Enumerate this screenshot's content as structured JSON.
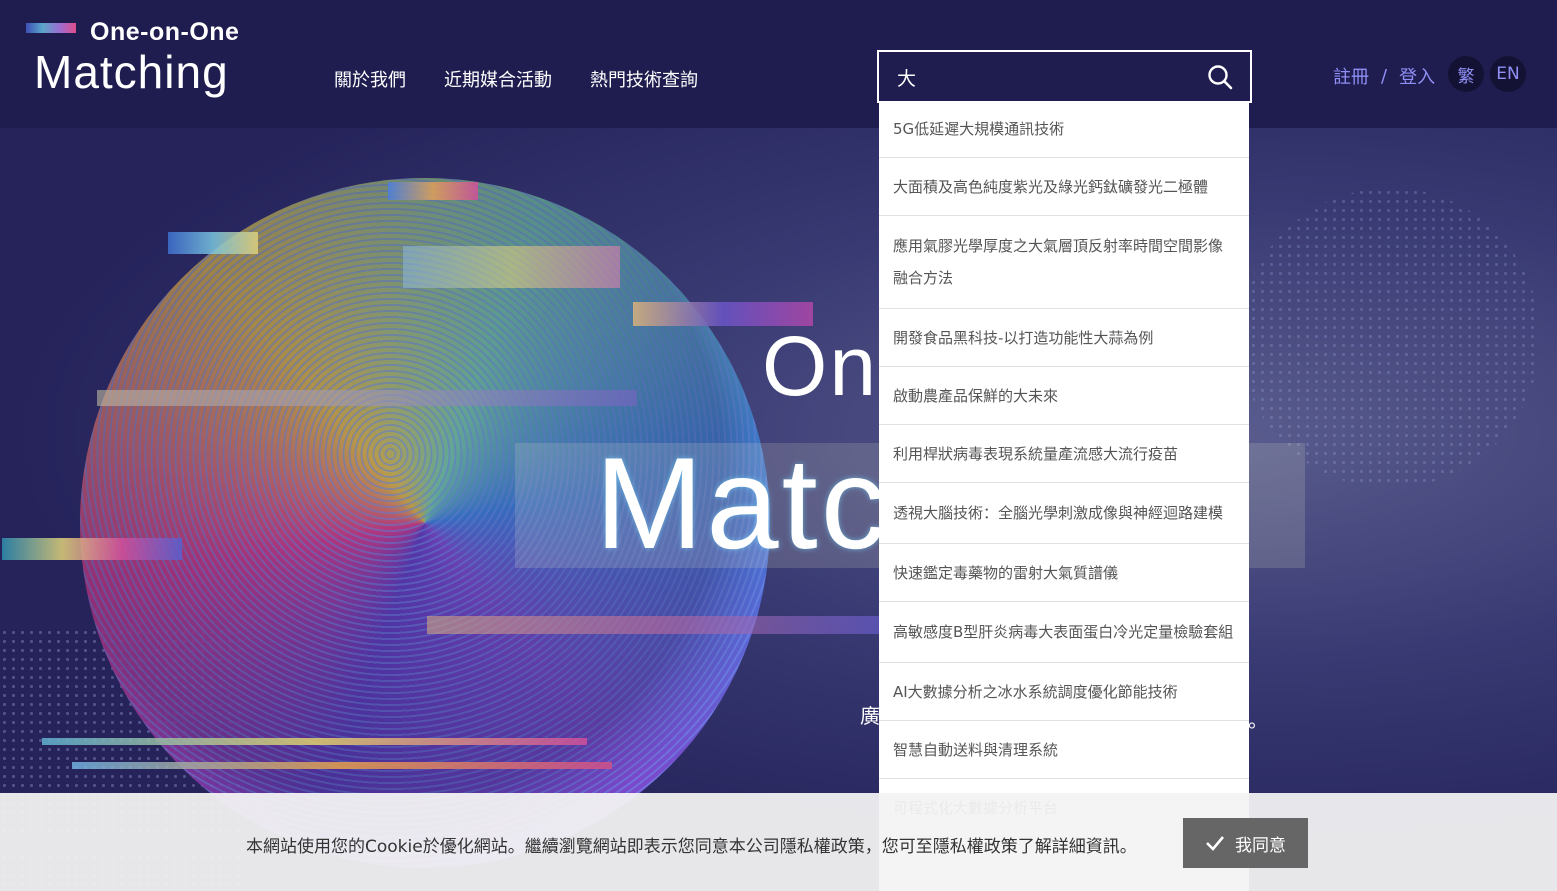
{
  "header": {
    "logo_top": "One-on-One",
    "logo_main": "Matching",
    "nav": [
      "關於我們",
      "近期媒合活動",
      "熱門技術查詢"
    ],
    "search_value": "大",
    "auth": {
      "register": "註冊",
      "separator": "/",
      "login": "登入"
    },
    "lang": {
      "zh": "繁",
      "en": "EN"
    }
  },
  "hero": {
    "title_top": "One-on-One",
    "title_main": "Matching",
    "sub_visible": "廣"
  },
  "suggestions": [
    "5G低延遲大規模通訊技術",
    "大面積及高色純度紫光及綠光鈣鈦礦發光二極體",
    "應用氣膠光學厚度之大氣層頂反射率時間空間影像融合方法",
    "開發食品黑科技-以打造功能性大蒜為例",
    "啟動農產品保鮮的大未來",
    "利用桿狀病毒表現系統量產流感大流行疫苗",
    "透視大腦技術：全腦光學刺激成像與神經迴路建模",
    "快速鑑定毒藥物的雷射大氣質譜儀",
    "高敏感度B型肝炎病毒大表面蛋白冷光定量檢驗套組",
    "AI大數據分析之冰水系統調度優化節能技術",
    "智慧自動送料與清理系統",
    "可程式化大數據分析平台"
  ],
  "cookie": {
    "text": "本網站使用您的Cookie於優化網站。繼續瀏覽網站即表示您同意本公司隱私權政策，您可至隱私權政策了解詳細資訊。",
    "accept_label": "我同意"
  },
  "colors": {
    "header_bg": "#1f1d4f",
    "accent_text": "#8f8ff5",
    "cookie_button": "#666666"
  }
}
